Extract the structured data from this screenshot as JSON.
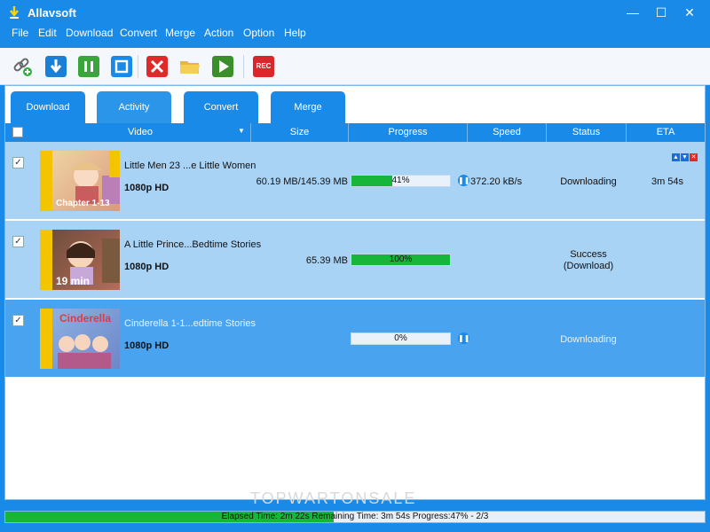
{
  "window": {
    "title": "Allavsoft",
    "controls": [
      "minimize",
      "maximize",
      "close"
    ],
    "min_glyph": "—",
    "max_glyph": "☐",
    "close_glyph": "✕"
  },
  "menu": [
    "File",
    "Edit",
    "Download",
    "Convert",
    "Merge",
    "Action",
    "Option",
    "Help"
  ],
  "toolbar": {
    "icons": [
      "link-add-icon",
      "download-icon",
      "pause-icon",
      "stop-icon",
      "delete-icon",
      "folder-icon",
      "play-icon",
      "record-icon"
    ],
    "rec_label": "REC"
  },
  "tabs": [
    "Download",
    "Activity",
    "Convert",
    "Merge"
  ],
  "columns": [
    "Video",
    "Size",
    "Progress",
    "Speed",
    "Status",
    "ETA"
  ],
  "rows": [
    {
      "title": "Little Men 23 ...e Little Women",
      "quality": "1080p HD",
      "thumb_label": "Chapter 1-13",
      "size": "60.19 MB/145.39 MB",
      "progress": 41,
      "progress_text": "41%",
      "speed": "372.20 kB/s",
      "status": "Downloading",
      "eta": "3m 54s"
    },
    {
      "title": "A Little Prince...Bedtime Stories",
      "quality": "1080p HD",
      "thumb_label": "19 min",
      "size": "65.39 MB",
      "progress": 100,
      "progress_text": "100%",
      "speed": "",
      "status": "Success",
      "status2": "(Download)",
      "eta": ""
    },
    {
      "title": "Cinderella 1-1...edtime Stories",
      "quality": "1080p HD",
      "thumb_label": "Cinderella",
      "size": "",
      "progress": 0,
      "progress_text": "0%",
      "speed": "",
      "status": "Downloading",
      "eta": ""
    }
  ],
  "statusbar": {
    "text": "Elapsed Time: 2m 22s Remaining Time: 3m 54s Progress:47% - 2/3",
    "progress": 47
  },
  "watermark": "TOPWARTONSALE",
  "colors": {
    "accent": "#1a8ae8",
    "row": "#a9d3f5",
    "selected": "#4aa3ef",
    "progress": "#18b53b"
  }
}
